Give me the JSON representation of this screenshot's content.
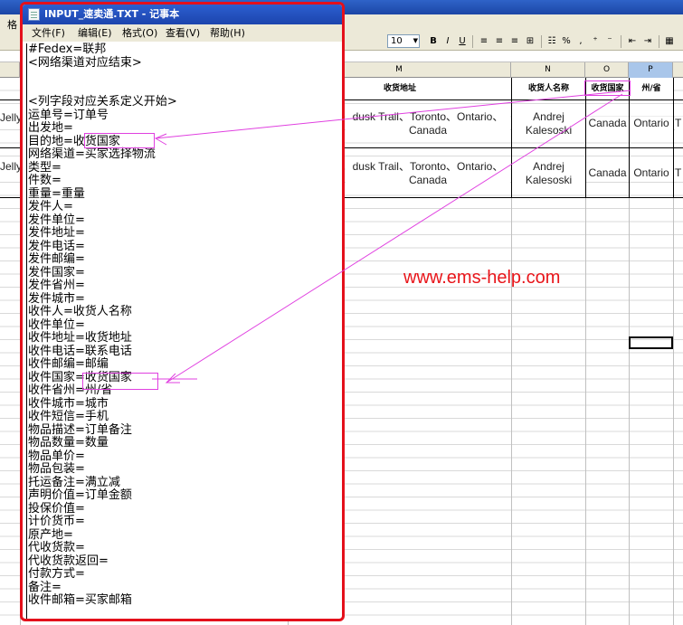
{
  "excel": {
    "menu_first": "格",
    "font_size": "10",
    "toolbar_buttons": [
      "B",
      "I",
      "U",
      "%",
      ","
    ],
    "columns": [
      {
        "label": "M"
      },
      {
        "label": "N"
      },
      {
        "label": "O"
      },
      {
        "label": "P"
      }
    ],
    "headers": {
      "m": "收货地址",
      "n": "收货人名称",
      "o": "收货国家",
      "p": "州/省"
    },
    "rows": [
      {
        "left": "Jelly",
        "address_line1": "dusk Trail、Toronto、Ontario、",
        "address_line2": "Canada",
        "name_line1": "Andrej",
        "name_line2": "Kalesoski",
        "country": "Canada",
        "province": "Ontario",
        "next": "T"
      },
      {
        "left": "Jelly",
        "address_line1": "dusk Trail、Toronto、Ontario、",
        "address_line2": "Canada",
        "name_line1": "Andrej",
        "name_line2": "Kalesoski",
        "country": "Canada",
        "province": "Ontario",
        "next": "T"
      }
    ]
  },
  "watermark": "www.ems-help.com",
  "notepad": {
    "title": "INPUT_速卖通.TXT - 记事本",
    "menu": [
      "文件(F)",
      "编辑(E)",
      "格式(O)",
      "查看(V)",
      "帮助(H)"
    ],
    "lines": [
      "#Fedex=联邦",
      "<网络渠道对应结束>",
      "",
      "",
      "<列字段对应关系定义开始>",
      "运单号=订单号",
      "出发地=",
      "目的地=收货国家",
      "网络渠道=买家选择物流",
      "类型=",
      "件数=",
      "重量=重量",
      "发件人=",
      "发件单位=",
      "发件地址=",
      "发件电话=",
      "发件邮编=",
      "发件国家=",
      "发件省州=",
      "发件城市=",
      "收件人=收货人名称",
      "收件单位=",
      "收件地址=收货地址",
      "收件电话=联系电话",
      "收件邮编=邮编",
      "收件国家=收货国家",
      "收件省州=州/省",
      "收件城市=城市",
      "收件短信=手机",
      "物品描述=订单备注",
      "物品数量=数量",
      "物品单价=",
      "物品包装=",
      "托运备注=满立减",
      "声明价值=订单金额",
      "投保价值=",
      "计价货币=",
      "原产地=",
      "代收货款=",
      "代收货款返回=",
      "付款方式=",
      "备注=",
      "收件邮箱=买家邮箱"
    ]
  },
  "colors": {
    "frame": "#e4101b",
    "annotation": "#e040e0",
    "watermark": "#e8151a"
  }
}
